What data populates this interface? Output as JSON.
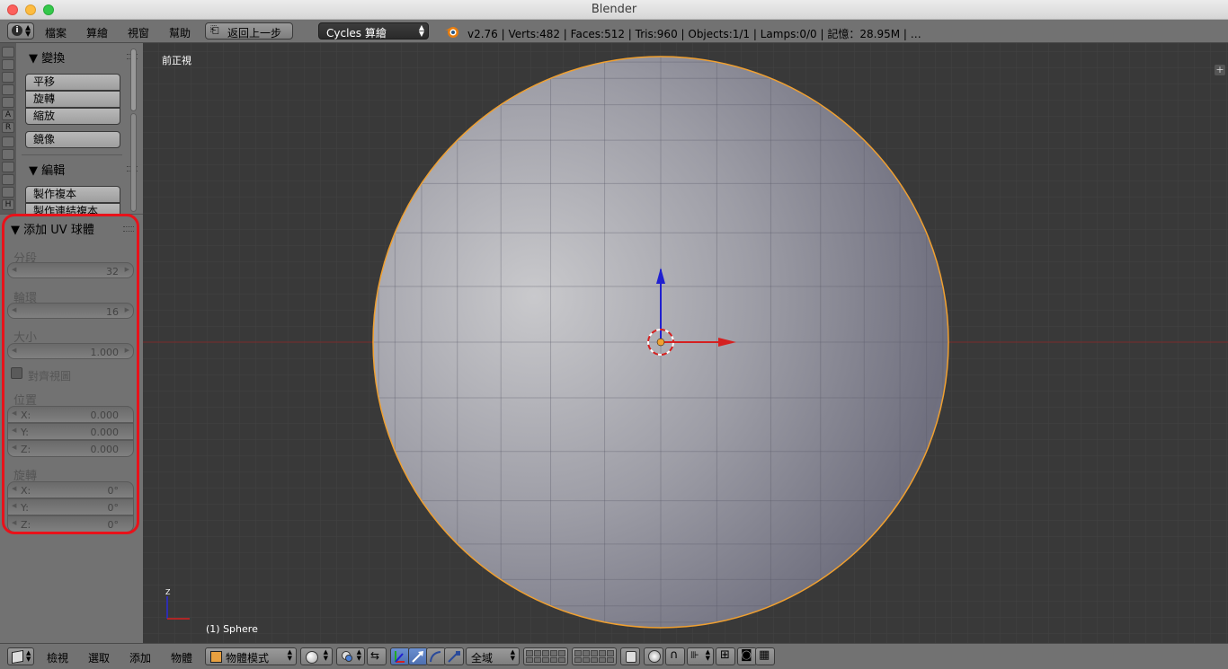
{
  "window": {
    "title": "Blender"
  },
  "header": {
    "menus": [
      "檔案",
      "算繪",
      "視窗",
      "幫助"
    ],
    "undo_label": "返回上一步",
    "engine": "Cycles 算繪",
    "stats": "v2.76 | Verts:482 | Faces:512 | Tris:960 | Objects:1/1 | Lamps:0/0 | 記憶：28.95M | …"
  },
  "tool_tabs": [
    "A",
    "R",
    "H"
  ],
  "toolshelf": {
    "transform_title": "變換",
    "transform_buttons": [
      "平移",
      "旋轉",
      "縮放",
      "鏡像"
    ],
    "edit_title": "編輯",
    "edit_buttons": [
      "製作複本",
      "製作連結複本"
    ]
  },
  "operator": {
    "title": "添加 UV 球體",
    "segments_label": "分段",
    "segments_value": "32",
    "rings_label": "輪環",
    "rings_value": "16",
    "size_label": "大小",
    "size_value": "1.000",
    "align_label": "對齊視圖",
    "location_label": "位置",
    "location": [
      {
        "axis": "X:",
        "value": "0.000"
      },
      {
        "axis": "Y:",
        "value": "0.000"
      },
      {
        "axis": "Z:",
        "value": "0.000"
      }
    ],
    "rotation_label": "旋轉",
    "rotation": [
      {
        "axis": "X:",
        "value": "0°"
      },
      {
        "axis": "Y:",
        "value": "0°"
      },
      {
        "axis": "Z:",
        "value": "0°"
      }
    ]
  },
  "viewport": {
    "view_label": "前正視",
    "object_label": "(1) Sphere",
    "axis_z": "Z",
    "colors": {
      "bg": "#393939",
      "grid": "#424242",
      "outline": "#f0a030",
      "x_axis": "#d52020",
      "z_axis": "#2020d0"
    }
  },
  "bottombar": {
    "menus": [
      "檢視",
      "選取",
      "添加",
      "物體"
    ],
    "mode": "物體模式",
    "orientation": "全域"
  }
}
